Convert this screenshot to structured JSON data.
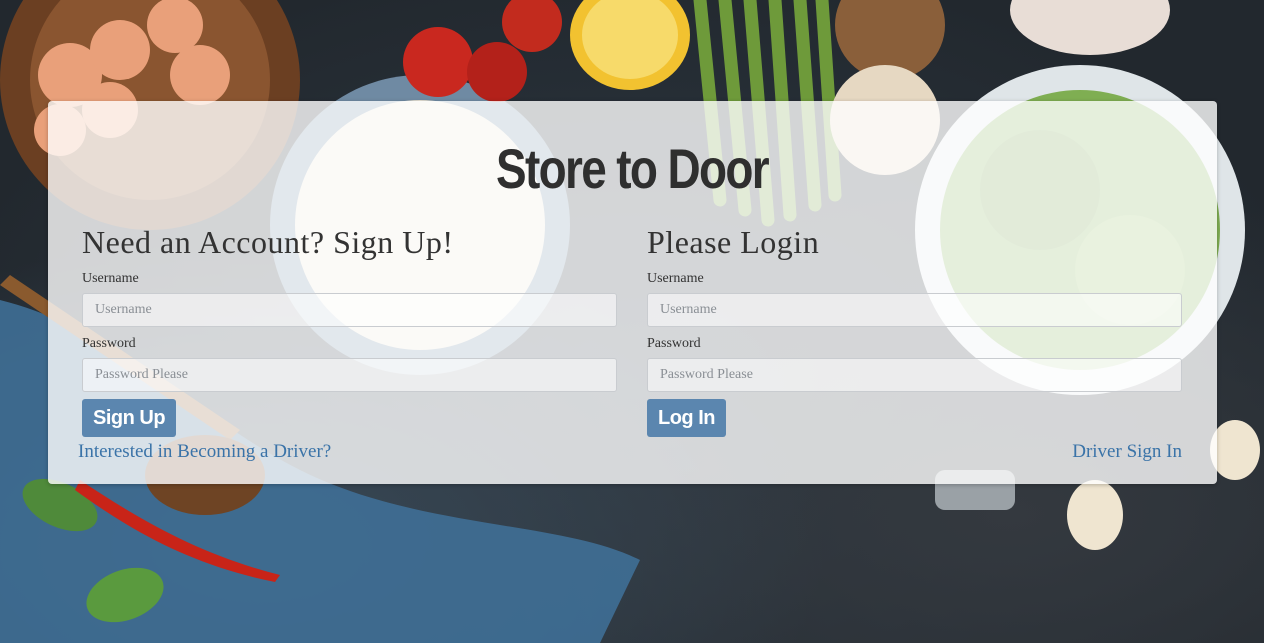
{
  "brand": {
    "title": "Store to Door"
  },
  "signup": {
    "heading": "Need an Account? Sign Up!",
    "username_label": "Username",
    "username_placeholder": "Username",
    "password_label": "Password",
    "password_placeholder": "Password Please",
    "button_label": "Sign Up",
    "driver_link": "Interested in Becoming a Driver?"
  },
  "login": {
    "heading": "Please Login",
    "username_label": "Username",
    "username_placeholder": "Username",
    "password_label": "Password",
    "password_placeholder": "Password Please",
    "button_label": "Log In",
    "driver_link": "Driver Sign In"
  },
  "colors": {
    "button": "#5b86af",
    "link": "#3a73a8",
    "title": "#2f2f2f"
  }
}
